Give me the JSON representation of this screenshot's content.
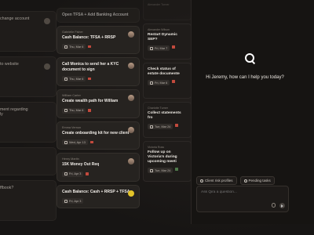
{
  "left_cards": [
    {
      "text": "change account"
    },
    {
      "text": "to website"
    },
    {
      "text": "ment regarding"
    },
    {
      "text": "ly"
    },
    {
      "text": "ffbook?"
    }
  ],
  "mid_cards": [
    {
      "who": "",
      "title": "Open TFSA + Add Banking Account",
      "date": "",
      "faded": true
    },
    {
      "who": "Gabrielle Fisher",
      "title": "Cash Balance: TFSA + RRSP",
      "date": "Thu, Mar 6"
    },
    {
      "who": "",
      "title": "Call Monica to send her a KYC document to sign",
      "date": "Thu, Mar 6"
    },
    {
      "who": "William Carter",
      "title": "Create wealth path for William",
      "date": "Thu, Mar 6"
    },
    {
      "who": "Emma Vernon",
      "title": "Create onboarding kit for new client",
      "date": "Wed, Apr 13"
    },
    {
      "who": "Henry Martin",
      "title": "15K Money Out Req",
      "date": "Fri, Apr 3"
    },
    {
      "who": "",
      "title": "Cash Balance: Cash + RRSP + TFSA",
      "date": "Fri, Apr 3"
    }
  ],
  "right_cards": [
    {
      "who": "Alexander Turner",
      "title": "",
      "date": ""
    },
    {
      "who": "Alexander Wilson",
      "title": "Restart Dynamic SEP?",
      "date": "Fri, Mar 7"
    },
    {
      "who": "",
      "title": "Check status of estate documente",
      "date": "Fri, Mar 6"
    },
    {
      "who": "Charlotte Turner",
      "title": "Collect statements fro",
      "date": "Tue, Mar 24"
    },
    {
      "who": "Victoria Ross",
      "title": "Follow up on Victoria's during upcoming meeti",
      "date": "Tue, Mar 24"
    }
  ],
  "assistant": {
    "greeting": "Hi Jeremy, how can I help you today?",
    "chips": [
      "Client risk profiles",
      "Pending tasks"
    ],
    "input_placeholder": "Ask Qira a question..."
  },
  "colors": {
    "flag_red": "#c34a3d",
    "avatar_yellow": "#e3c429",
    "panel_bg": "#161412"
  }
}
